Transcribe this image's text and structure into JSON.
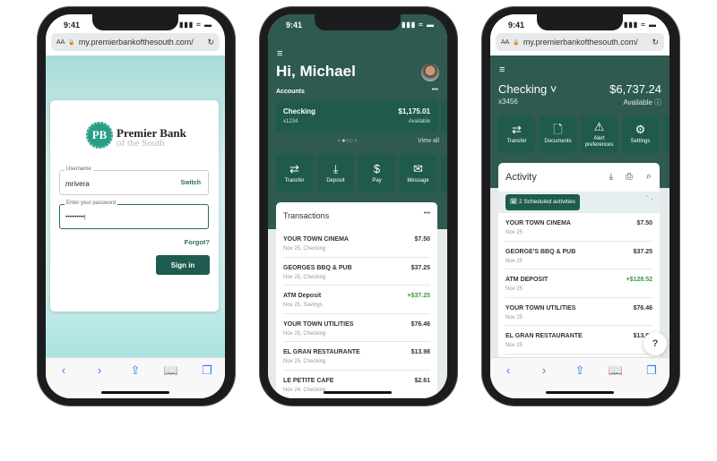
{
  "status": {
    "time": "9:41",
    "signal": "▮▮▮ ≈ ▬"
  },
  "browser": {
    "aa": "AA",
    "url": "my.premierbankofthesouth.com/",
    "lock": "🔒",
    "reload": "↻",
    "toolbar_icons": [
      "‹",
      "›",
      "⇪",
      "📖",
      "❐"
    ]
  },
  "login": {
    "logo_mark": "PB",
    "logo_title": "Premier Bank",
    "logo_subtitle": "of the South",
    "username_label": "Username",
    "username_value": "mrivera",
    "switch": "Switch",
    "password_label": "Enter your password",
    "password_value": "••••••••••|",
    "forgot": "Forgot?",
    "sign_in": "Sign in"
  },
  "dashboard": {
    "menu": "≡",
    "greeting": "Hi, Michael",
    "accounts_label": "Accounts",
    "more": "•••",
    "account": {
      "name": "Checking",
      "number": "x1234",
      "balance": "$1,175.01",
      "balance_label": "Available"
    },
    "pager": "‹ ●○○ ›",
    "view_all": "View all",
    "actions": [
      {
        "icon": "⇄",
        "label": "Transfer"
      },
      {
        "icon": "⤓",
        "label": "Deposit"
      },
      {
        "icon": "$",
        "label": "Pay"
      },
      {
        "icon": "✉",
        "label": "Message"
      }
    ],
    "transactions_title": "Transactions",
    "transactions": [
      {
        "name": "YOUR TOWN CINEMA",
        "date": "Nov 25, Checking",
        "amount": "$7.50"
      },
      {
        "name": "GEORGES BBQ & PUB",
        "date": "Nov 25, Checking",
        "amount": "$37.25"
      },
      {
        "name": "ATM Deposit",
        "date": "Nov 25, Savings",
        "amount": "+$37.25",
        "positive": true
      },
      {
        "name": "YOUR TOWN UTILITIES",
        "date": "Nov 25, Checking",
        "amount": "$76.46"
      },
      {
        "name": "EL GRAN RESTAURANTE",
        "date": "Nov 25, Checking",
        "amount": "$13.98"
      },
      {
        "name": "LE PETITE CAFE",
        "date": "Nov 24, Checking",
        "amount": "$2.61"
      }
    ]
  },
  "account": {
    "menu": "≡",
    "name": "Checking ˅",
    "number": "x3456",
    "balance": "$6,737.24",
    "balance_label": "Available ⓘ",
    "actions": [
      {
        "icon": "⇄",
        "label": "Transfer"
      },
      {
        "icon": "🗋",
        "label": "Documents"
      },
      {
        "icon": "⚠",
        "label": "Alert preferences"
      },
      {
        "icon": "⚙",
        "label": "Settings"
      }
    ],
    "activity_title": "Activity",
    "activity_icons": [
      "⤓",
      "⎙",
      "⌕"
    ],
    "scheduled": "🗓 2 Scheduled activities",
    "expand": "⌃⌄",
    "help": "?",
    "activities": [
      {
        "name": "YOUR TOWN CINEMA",
        "date": "Nov 25",
        "amount": "$7.50"
      },
      {
        "name": "GEORGE'S BBQ & PUB",
        "date": "Nov 25",
        "amount": "$37.25"
      },
      {
        "name": "ATM DEPOSIT",
        "date": "Nov 25",
        "amount": "+$128.52",
        "positive": true
      },
      {
        "name": "YOUR TOWN UTILITIES",
        "date": "Nov 25",
        "amount": "$76.46"
      },
      {
        "name": "EL GRAN RESTAURANTE",
        "date": "Nov 25",
        "amount": "$13.98"
      }
    ]
  },
  "colors": {
    "brand_green": "#1f5b4f",
    "header_green": "#2e5a50",
    "positive": "#3a9b3a",
    "link_blue": "#3478f6"
  }
}
